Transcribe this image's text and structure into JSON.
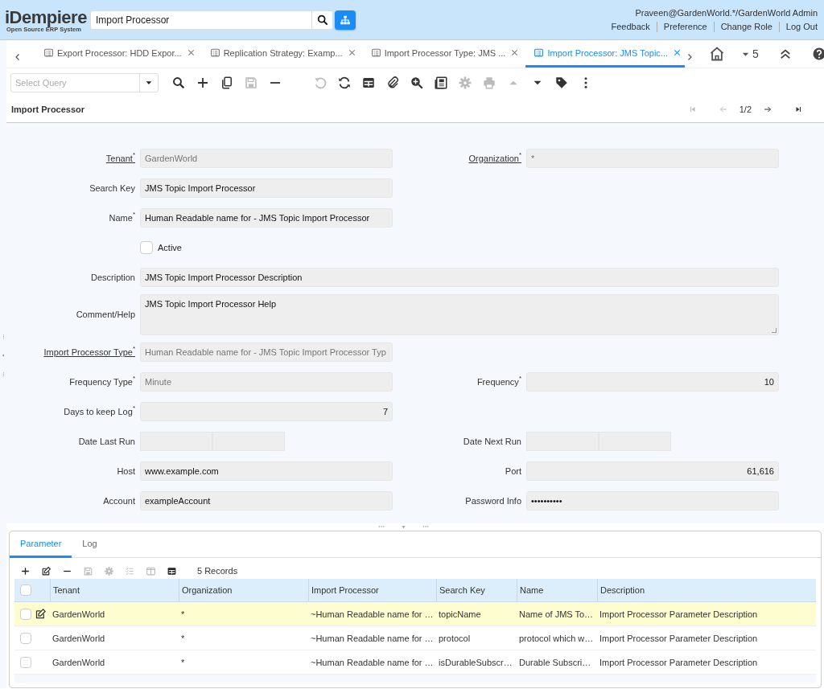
{
  "header": {
    "logo": "iDempiere",
    "logo_tagline": "Open Source ERP System",
    "search": {
      "value": "Import Processor"
    },
    "user": "Praveen@GardenWorld.*/GardenWorld Admin",
    "links": [
      "Feedback",
      "Preference",
      "Change Role",
      "Log Out"
    ]
  },
  "window_tabs": [
    {
      "label": "Export Processor: HDD Expor...",
      "selected": false
    },
    {
      "label": "Replication Strategy: Examp...",
      "selected": false
    },
    {
      "label": "Import Processor Type: JMS ...",
      "selected": false
    },
    {
      "label": "Import Processor: JMS Topic...",
      "selected": true
    }
  ],
  "window_count": "5",
  "toolbar": {
    "query": {
      "placeholder": "Select Query"
    },
    "buttons": [
      {
        "kind": "search",
        "disabled": false
      },
      {
        "kind": "plus",
        "disabled": false
      },
      {
        "kind": "copy",
        "disabled": false
      },
      {
        "kind": "save",
        "disabled": true
      },
      {
        "kind": "minus",
        "disabled": false
      },
      {
        "kind": "undo",
        "disabled": true
      },
      {
        "kind": "refresh",
        "disabled": false
      },
      {
        "kind": "grid",
        "disabled": false
      },
      {
        "kind": "attach",
        "disabled": false
      },
      {
        "kind": "zoom",
        "disabled": false
      },
      {
        "kind": "report",
        "disabled": false
      },
      {
        "kind": "gear",
        "disabled": true
      },
      {
        "kind": "print",
        "disabled": true
      },
      {
        "kind": "up",
        "disabled": true
      },
      {
        "kind": "down",
        "disabled": false
      },
      {
        "kind": "tag",
        "disabled": false
      },
      {
        "kind": "more",
        "disabled": false
      }
    ]
  },
  "title": "Import Processor",
  "record_nav": {
    "first": {
      "disabled": true
    },
    "prev": {
      "disabled": true
    },
    "position": "1/2",
    "next": {
      "disabled": false
    },
    "last": {
      "disabled": false
    }
  },
  "form": [
    [
      {
        "kind": "text",
        "label": "Tenant$^{*}$",
        "link": true,
        "value": "GardenWorld",
        "readonly": true
      },
      {
        "kind": "text",
        "label": "Organization$^{*}$",
        "link": true,
        "value": "*",
        "readonly": true
      }
    ],
    [
      {
        "kind": "text",
        "label": "Search Key",
        "value": "JMS Topic Import Processor"
      }
    ],
    [
      {
        "kind": "text",
        "label": "Name$^{*}$",
        "value": "Human Readable name for - JMS Topic Import Processor"
      }
    ],
    [
      {
        "kind": "checkbox",
        "label": "Active",
        "checked": false
      }
    ],
    [
      {
        "kind": "wide",
        "label": "Description",
        "value": "JMS Topic Import Processor Description"
      }
    ],
    [
      {
        "kind": "textarea",
        "label": "Comment/Help",
        "value": "JMS Topic Import Processor Help"
      }
    ],
    [
      {
        "kind": "text",
        "label": "Import Processor Type$^{*}$",
        "link": true,
        "value": "Human Readable name for - JMS Topic Import Processor Typ",
        "readonly": true
      }
    ],
    [
      {
        "kind": "text",
        "label": "Frequency Type$^{*}$",
        "value": "Minute",
        "readonly": true
      },
      {
        "kind": "number",
        "label": "Frequency$^{*}$",
        "value": "10"
      }
    ],
    [
      {
        "kind": "number",
        "label": "Days to keep Log$^{*}$",
        "value": "7"
      }
    ],
    [
      {
        "kind": "date",
        "label": "Date Last Run"
      },
      {
        "kind": "date",
        "label": "Date Next Run"
      }
    ],
    [
      {
        "kind": "text",
        "label": "Host",
        "value": "www.example.com"
      },
      {
        "kind": "number",
        "label": "Port",
        "value": "61,616"
      }
    ],
    [
      {
        "kind": "text",
        "label": "Account",
        "value": "exampleAccount"
      },
      {
        "kind": "text",
        "label": "Password Info",
        "value": "••••••••••"
      }
    ]
  ],
  "detail": {
    "tabs": [
      {
        "label": "Parameter",
        "selected": true
      },
      {
        "label": "Log",
        "selected": false
      }
    ],
    "toolbar": [
      {
        "kind": "plus",
        "disabled": false
      },
      {
        "kind": "edit",
        "disabled": false
      },
      {
        "kind": "minus",
        "disabled": false
      },
      {
        "kind": "save",
        "disabled": true
      },
      {
        "kind": "gear",
        "disabled": true
      },
      {
        "kind": "checklist",
        "disabled": true
      },
      {
        "kind": "columns",
        "disabled": true
      },
      {
        "kind": "grid",
        "disabled": false
      }
    ],
    "record_count": "5 Records",
    "columns": [
      "Tenant",
      "Organization",
      "Import Processor",
      "Search Key",
      "Name",
      "Description"
    ],
    "header_checked": false,
    "rows": [
      {
        "current": true,
        "checked": false,
        "cells": [
          "GardenWorld",
          "*",
          "~Human Readable name for …",
          "topicName",
          "Name of JMS To…",
          "Import Processor Parameter Description"
        ]
      },
      {
        "current": false,
        "checked": false,
        "cells": [
          "GardenWorld",
          "*",
          "~Human Readable name for …",
          "protocol",
          "protocol which w…",
          "Import Processor Parameter Description"
        ]
      },
      {
        "current": false,
        "checked": false,
        "cells": [
          "GardenWorld",
          "*",
          "~Human Readable name for …",
          "isDurableSubscr…",
          "Durable Subscri…",
          "Import Processor Parameter Description"
        ]
      }
    ]
  }
}
